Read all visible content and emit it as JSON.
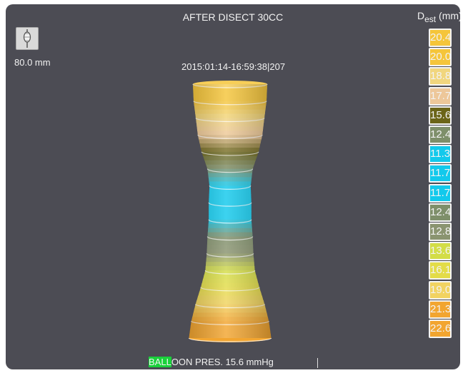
{
  "header": {
    "title": "AFTER DISECT 30CC",
    "dest_label": "D",
    "dest_sub": "est",
    "dest_unit": " (mm)"
  },
  "toolbar": {
    "probe_icon": "balloon-catheter-icon",
    "length_label": "80.0 mm"
  },
  "timestamp": "2015:01:14-16:59:38|207",
  "status": {
    "balloon_highlight": "BALL",
    "balloon_rest": "OON PRES. 15.6 mmHg",
    "highlight_color": "#19d13a"
  },
  "diameters": [
    {
      "value": "20.4",
      "color": "#f5c53a"
    },
    {
      "value": "20.0",
      "color": "#f5c53a"
    },
    {
      "value": "18.8",
      "color": "#f1d67e"
    },
    {
      "value": "17.7",
      "color": "#edc79a"
    },
    {
      "value": "15.6",
      "color": "#6b6418"
    },
    {
      "value": "12.4",
      "color": "#7e8f6a"
    },
    {
      "value": "11.3",
      "color": "#12c9ec"
    },
    {
      "value": "11.7",
      "color": "#12c9ec"
    },
    {
      "value": "11.7",
      "color": "#12c9ec"
    },
    {
      "value": "12.4",
      "color": "#7e8f6a"
    },
    {
      "value": "12.8",
      "color": "#8a9470"
    },
    {
      "value": "13.6",
      "color": "#d3dd47"
    },
    {
      "value": "16.1",
      "color": "#e3dc48"
    },
    {
      "value": "19.0",
      "color": "#f2d361"
    },
    {
      "value": "21.3",
      "color": "#f2a530"
    },
    {
      "value": "22.6",
      "color": "#f2a530"
    }
  ]
}
